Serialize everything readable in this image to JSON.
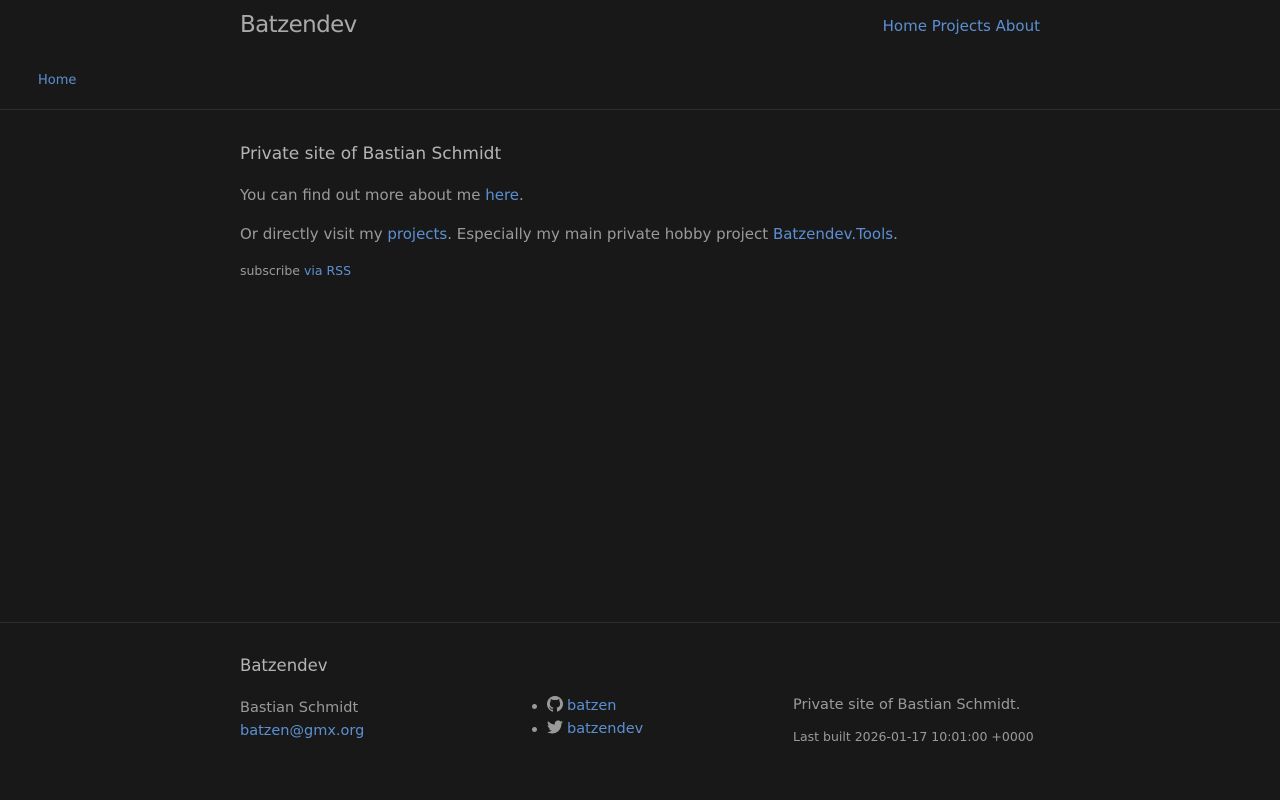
{
  "header": {
    "site_title": "Batzendev",
    "nav": [
      "Home",
      "Projects",
      "About"
    ],
    "breadcrumb": "Home"
  },
  "main": {
    "title": "Private site of Bastian Schmidt",
    "p1_prefix": "You can find out more about me ",
    "p1_link": "here",
    "p1_suffix": ".",
    "p2_prefix": "Or directly visit my ",
    "p2_link1": "projects",
    "p2_mid": ". Especially my main private hobby project ",
    "p2_link2": "Batzendev.Tools",
    "p2_suffix": ".",
    "rss_prefix": "subscribe ",
    "rss_link": "via RSS"
  },
  "footer": {
    "title": "Batzendev",
    "name": "Bastian Schmidt",
    "email": "batzen@gmx.org",
    "social": [
      {
        "icon": "github-icon",
        "label": "batzen"
      },
      {
        "icon": "twitter-icon",
        "label": "batzendev"
      }
    ],
    "description": "Private site of Bastian Schmidt.",
    "last_built": "Last built 2026-01-17 10:01:00 +0000"
  },
  "colors": {
    "background": "#181818",
    "link": "#5c8fd1",
    "text": "#9a9a9a"
  }
}
